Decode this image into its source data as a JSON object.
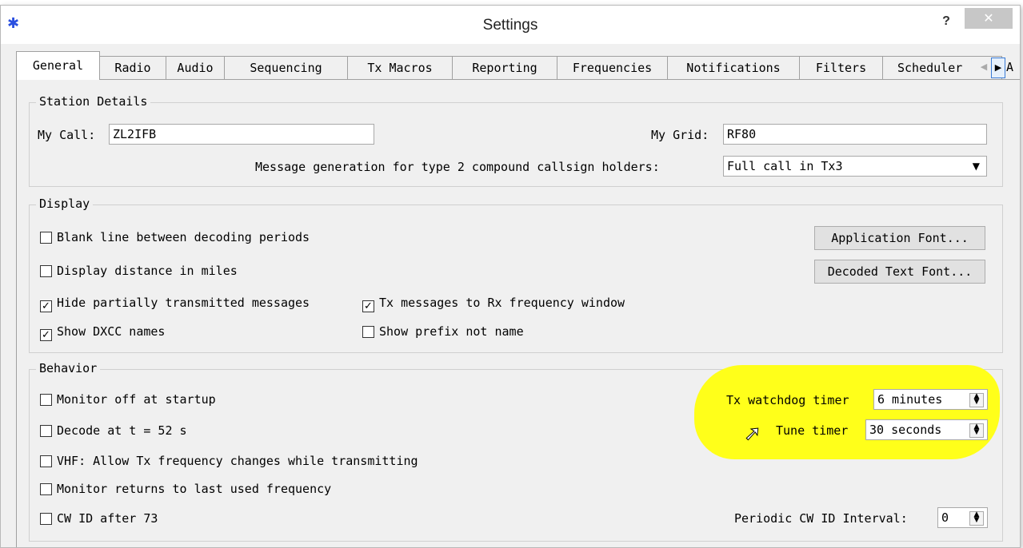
{
  "window": {
    "title": "Settings",
    "help_label": "?",
    "close_label": "✕",
    "app_icon": "star-icon"
  },
  "tabs": [
    {
      "label": "General",
      "active": true
    },
    {
      "label": "Radio"
    },
    {
      "label": "Audio"
    },
    {
      "label": "Sequencing"
    },
    {
      "label": "Tx Macros"
    },
    {
      "label": "Reporting"
    },
    {
      "label": "Frequencies"
    },
    {
      "label": "Notifications"
    },
    {
      "label": "Filters"
    },
    {
      "label": "Scheduler"
    }
  ],
  "tab_cut_label": "A",
  "station": {
    "title": "Station Details",
    "my_call_label": "My Call:",
    "my_call_value": "ZL2IFB",
    "my_grid_label": "My Grid:",
    "my_grid_value": "RF80",
    "msg_gen_label": "Message generation for type 2 compound callsign holders:",
    "msg_gen_value": "Full call in Tx3"
  },
  "display": {
    "title": "Display",
    "blank_line": {
      "label": "Blank line between decoding periods",
      "checked": false
    },
    "distance_miles": {
      "label": "Display distance in miles",
      "checked": false
    },
    "hide_partial": {
      "label": "Hide partially transmitted messages",
      "checked": true
    },
    "tx_to_rx": {
      "label": "Tx messages to Rx frequency window",
      "checked": true
    },
    "show_dxcc": {
      "label": "Show DXCC names",
      "checked": true
    },
    "show_prefix": {
      "label": "Show prefix not name",
      "checked": false
    },
    "app_font_button": "Application Font...",
    "decoded_font_button": "Decoded Text Font..."
  },
  "behavior": {
    "title": "Behavior",
    "monitor_off": {
      "label": "Monitor off at startup",
      "checked": false
    },
    "decode_at": {
      "label": "Decode at t = 52 s",
      "checked": false
    },
    "vhf_allow": {
      "label": "VHF: Allow Tx frequency changes while transmitting",
      "checked": false
    },
    "monitor_returns": {
      "label": "Monitor returns to last used frequency",
      "checked": false
    },
    "cw_id": {
      "label": "CW ID after 73",
      "checked": false
    },
    "tx_watchdog_label": "Tx watchdog timer",
    "tx_watchdog_value": "6 minutes",
    "tune_timer_label": "Tune timer",
    "tune_timer_value": "30 seconds",
    "periodic_cw_label": "Periodic CW ID Interval:",
    "periodic_cw_value": "0"
  },
  "colors": {
    "highlight": "#ffff1a",
    "icon": "#2a4fe0"
  }
}
